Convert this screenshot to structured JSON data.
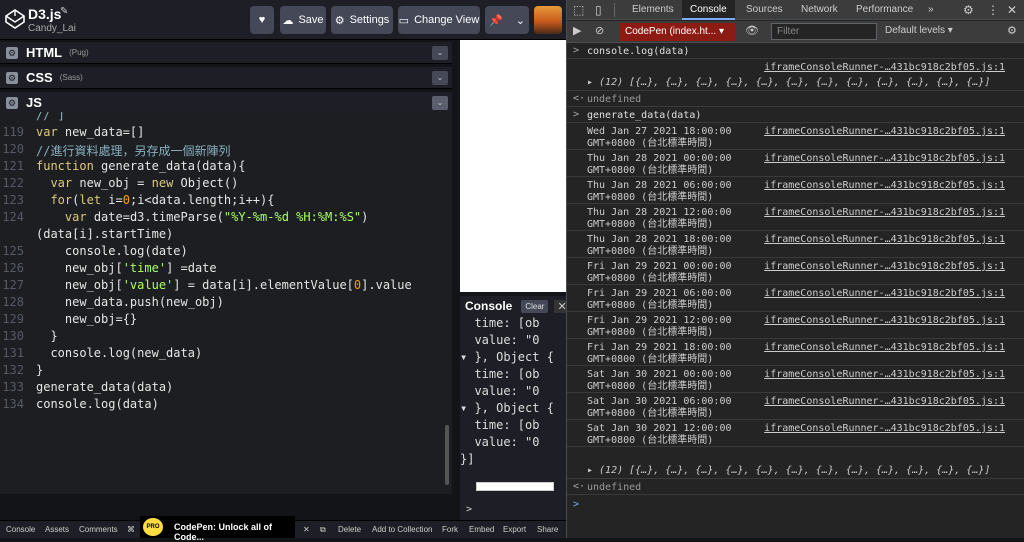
{
  "codepen": {
    "title": "D3.js",
    "author": "Candy_Lai",
    "buttons": {
      "save": "Save",
      "settings": "Settings",
      "change_view": "Change View"
    },
    "panes": [
      {
        "lang": "HTML",
        "pre": "(Pug)"
      },
      {
        "lang": "CSS",
        "pre": "(Sass)"
      },
      {
        "lang": "JS",
        "pre": ""
      }
    ],
    "code_lines": [
      {
        "n": "",
        "t": "// ]"
      },
      {
        "n": "119",
        "t": "var new_data=[]"
      },
      {
        "n": "120",
        "t": "//進行資料處理，另存成一個新陣列"
      },
      {
        "n": "121",
        "t": "function generate_data(data){"
      },
      {
        "n": "122",
        "t": "  var new_obj = new Object()"
      },
      {
        "n": "123",
        "t": "  for(let i=0;i<data.length;i++){"
      },
      {
        "n": "124",
        "t": "    var date=d3.timeParse(\"%Y-%m-%d %H:%M:%S\")"
      },
      {
        "n": "",
        "t": "(data[i].startTime)"
      },
      {
        "n": "125",
        "t": "    console.log(date)"
      },
      {
        "n": "126",
        "t": "    new_obj['time'] =date"
      },
      {
        "n": "127",
        "t": "    new_obj['value'] = data[i].elementValue[0].value"
      },
      {
        "n": "128",
        "t": "    new_data.push(new_obj)"
      },
      {
        "n": "129",
        "t": "    new_obj={}"
      },
      {
        "n": "130",
        "t": "  }"
      },
      {
        "n": "131",
        "t": "  console.log(new_data)"
      },
      {
        "n": "132",
        "t": "}"
      },
      {
        "n": "133",
        "t": "generate_data(data)"
      },
      {
        "n": "134",
        "t": "console.log(data)"
      }
    ],
    "console": {
      "title": "Console",
      "clear": "Clear",
      "lines": [
        "  time: [ob",
        "  value: \"0",
        "▾ }, Object {",
        "  time: [ob",
        "  value: \"0",
        "▾ }, Object {",
        "  time: [ob",
        "  value: \"0",
        "}]"
      ],
      "prompt": ">"
    },
    "bottom_bar": [
      "Console",
      "Assets",
      "Comments",
      "⌘",
      "Delete",
      "Add to Collection",
      "Fork",
      "Embed",
      "Export",
      "Share"
    ],
    "pro_banner": {
      "badge": "PRO",
      "text": "CodePen: Unlock all of Code..."
    }
  },
  "devtools": {
    "tabs": [
      "Elements",
      "Console",
      "Sources",
      "Network",
      "Performance",
      "»"
    ],
    "active_tab": "Console",
    "context": "CodePen (index.ht...",
    "filter_placeholder": "Filter",
    "levels": "Default levels ▾",
    "entries": [
      {
        "kind": "input",
        "text": "console.log(data)"
      },
      {
        "kind": "log",
        "text": "▸ (12) [{…}, {…}, {…}, {…}, {…}, {…}, {…}, {…}, {…}, {…}, {…}, {…}]",
        "src": "iframeConsoleRunner-…431bc918c2bf05.js:1"
      },
      {
        "kind": "result",
        "text": "undefined"
      },
      {
        "kind": "input",
        "text": "generate_data(data)"
      },
      {
        "kind": "log",
        "text": "Wed Jan 27 2021 18:00:00\nGMT+0800 (台北標準時間)",
        "src": "iframeConsoleRunner-…431bc918c2bf05.js:1"
      },
      {
        "kind": "log",
        "text": "Thu Jan 28 2021 00:00:00\nGMT+0800 (台北標準時間)",
        "src": "iframeConsoleRunner-…431bc918c2bf05.js:1"
      },
      {
        "kind": "log",
        "text": "Thu Jan 28 2021 06:00:00\nGMT+0800 (台北標準時間)",
        "src": "iframeConsoleRunner-…431bc918c2bf05.js:1"
      },
      {
        "kind": "log",
        "text": "Thu Jan 28 2021 12:00:00\nGMT+0800 (台北標準時間)",
        "src": "iframeConsoleRunner-…431bc918c2bf05.js:1"
      },
      {
        "kind": "log",
        "text": "Thu Jan 28 2021 18:00:00\nGMT+0800 (台北標準時間)",
        "src": "iframeConsoleRunner-…431bc918c2bf05.js:1"
      },
      {
        "kind": "log",
        "text": "Fri Jan 29 2021 00:00:00\nGMT+0800 (台北標準時間)",
        "src": "iframeConsoleRunner-…431bc918c2bf05.js:1"
      },
      {
        "kind": "log",
        "text": "Fri Jan 29 2021 06:00:00\nGMT+0800 (台北標準時間)",
        "src": "iframeConsoleRunner-…431bc918c2bf05.js:1"
      },
      {
        "kind": "log",
        "text": "Fri Jan 29 2021 12:00:00\nGMT+0800 (台北標準時間)",
        "src": "iframeConsoleRunner-…431bc918c2bf05.js:1"
      },
      {
        "kind": "log",
        "text": "Fri Jan 29 2021 18:00:00\nGMT+0800 (台北標準時間)",
        "src": "iframeConsoleRunner-…431bc918c2bf05.js:1"
      },
      {
        "kind": "log",
        "text": "Sat Jan 30 2021 00:00:00\nGMT+0800 (台北標準時間)",
        "src": "iframeConsoleRunner-…431bc918c2bf05.js:1"
      },
      {
        "kind": "log",
        "text": "Sat Jan 30 2021 06:00:00\nGMT+0800 (台北標準時間)",
        "src": "iframeConsoleRunner-…431bc918c2bf05.js:1"
      },
      {
        "kind": "log",
        "text": "Sat Jan 30 2021 12:00:00\nGMT+0800 (台北標準時間)",
        "src": "iframeConsoleRunner-…431bc918c2bf05.js:1"
      },
      {
        "kind": "log",
        "text": "▸ (12) [{…}, {…}, {…}, {…}, {…}, {…}, {…}, {…}, {…}, {…}, {…}, {…}]",
        "src": ""
      },
      {
        "kind": "result",
        "text": "undefined"
      }
    ]
  },
  "colors": {
    "accent": "#7cacf8",
    "context_bg": "#8c1b13",
    "codepen_bg": "#1d1e22"
  }
}
